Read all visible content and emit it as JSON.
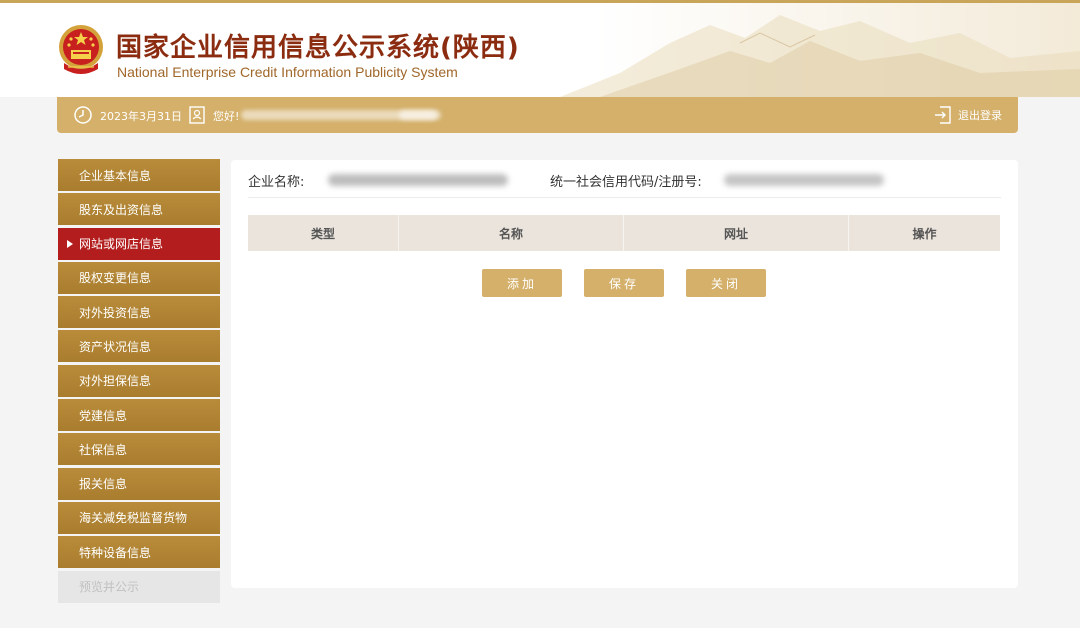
{
  "header": {
    "title": "国家企业信用信息公示系统",
    "region": "(陕西)",
    "subtitle": "National Enterprise Credit Information Publicity System"
  },
  "infobar": {
    "date": "2023年3月31日",
    "greeting": "您好!",
    "logout_label": "退出登录"
  },
  "sidebar": {
    "items": [
      {
        "label": "企业基本信息",
        "state": "normal"
      },
      {
        "label": "股东及出资信息",
        "state": "normal"
      },
      {
        "label": "网站或网店信息",
        "state": "active"
      },
      {
        "label": "股权变更信息",
        "state": "normal"
      },
      {
        "label": "对外投资信息",
        "state": "normal"
      },
      {
        "label": "资产状况信息",
        "state": "normal"
      },
      {
        "label": "对外担保信息",
        "state": "normal"
      },
      {
        "label": "党建信息",
        "state": "normal"
      },
      {
        "label": "社保信息",
        "state": "normal"
      },
      {
        "label": "报关信息",
        "state": "normal"
      },
      {
        "label": "海关减免税监督货物",
        "state": "normal"
      },
      {
        "label": "特种设备信息",
        "state": "normal"
      },
      {
        "label": "预览并公示",
        "state": "disabled"
      }
    ]
  },
  "main": {
    "company_name_label": "企业名称:",
    "credit_code_label": "统一社会信用代码/注册号:",
    "table": {
      "columns": [
        "类型",
        "名称",
        "网址",
        "操作"
      ]
    },
    "buttons": {
      "add": "添加",
      "save": "保存",
      "close": "关闭"
    }
  },
  "colors": {
    "gold": "#d4b06a",
    "sidebar_bg": "#b08432",
    "active_red": "#b31d1d",
    "title_red": "#8b2c10"
  }
}
